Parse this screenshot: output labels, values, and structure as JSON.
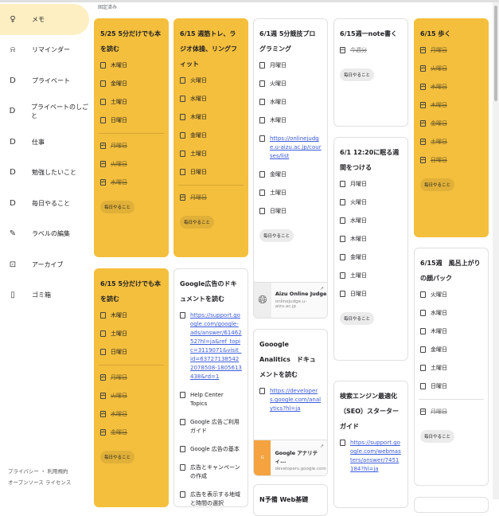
{
  "sidebar": {
    "items": [
      {
        "label": "メモ",
        "icon": "lightbulb-icon"
      },
      {
        "label": "リマインダー",
        "icon": "bell-icon"
      },
      {
        "label": "プライベート",
        "icon": "label-icon"
      },
      {
        "label": "プライベートのしごと",
        "icon": "label-icon"
      },
      {
        "label": "仕事",
        "icon": "label-icon"
      },
      {
        "label": "勉強したいこと",
        "icon": "label-icon"
      },
      {
        "label": "毎日やること",
        "icon": "label-icon"
      },
      {
        "label": "ラベルの編集",
        "icon": "pencil-icon"
      },
      {
        "label": "アーカイブ",
        "icon": "archive-icon"
      },
      {
        "label": "ゴミ箱",
        "icon": "trash-icon"
      }
    ],
    "footer": {
      "privacy": "プライバシー ・ 利用規約",
      "oss": "オープンソース ライセンス"
    }
  },
  "section": {
    "pinned": "固定済み"
  },
  "colors": {
    "yellow": "#f4bf3d",
    "active": "#feefc3"
  },
  "notes": [
    {
      "title": "5/25 5分だけでも本を読む",
      "color": "yellow",
      "items": [
        "木曜日",
        "金曜日",
        "土曜日",
        "日曜日"
      ],
      "done": [
        "月曜日",
        "火曜日",
        "水曜日"
      ],
      "label": "毎日やること"
    },
    {
      "title": "6/15 5分だけでも本を読む",
      "color": "yellow",
      "items": [
        "木曜日",
        "土曜日",
        "日曜日"
      ],
      "done": [
        "月曜日",
        "火曜日",
        "水曜日",
        "金曜日"
      ],
      "label": "毎日やること"
    },
    {
      "title": "6/15 週筋トレ、ラジオ体操、リングフィット",
      "color": "yellow",
      "items": [
        "火曜日",
        "水曜日",
        "木曜日",
        "金曜日",
        "土曜日",
        "日曜日"
      ],
      "done": [
        "月曜日"
      ],
      "label": "毎日やること"
    },
    {
      "title": "Google広告のドキュメントを読む",
      "color": "white",
      "items": [
        "https://support.google.com/google-ads/answer/6146252?hl=ja&ref_topic=3119071&visit_id=637271385422078508-1805613438&rd=1",
        "Help Center Topics",
        "Google 広告ご利用ガイド",
        "Google 広告の基本",
        "広告とキャンペーンの作成",
        "広告を表示する地域と時間の選択"
      ],
      "done": []
    },
    {
      "title": "6/1週 5分競技プログラミング",
      "color": "white",
      "items": [
        "月曜日",
        "火曜日",
        "水曜日",
        "木曜日",
        "https://onlinejudge.u-aizu.ac.jp/courses/list",
        "金曜日",
        "土曜日",
        "日曜日"
      ],
      "done": [],
      "label": "毎日やること",
      "preview": {
        "title": "Aizu Online Judge",
        "domain": "onlinejudge.u-aizu.ac.jp",
        "icon": "globe-icon"
      }
    },
    {
      "title": "Gooogle Analitics　ドキュメントを読む",
      "color": "white",
      "items": [
        "https://developers.google.com/analytics?hl=ja"
      ],
      "done": [],
      "preview": {
        "title": "Google アナリティ...",
        "domain": "developers.google.com",
        "icon": "google-developers-thumb"
      }
    },
    {
      "title": "N予備 Web基礎",
      "color": "white",
      "items": [],
      "done": []
    },
    {
      "title": "6/15週一note書く",
      "color": "white",
      "items": [],
      "done": [
        "今週分"
      ],
      "label": "毎日やること"
    },
    {
      "title": "6/1 12:20に眠る週間をつける",
      "color": "white",
      "items": [
        "月曜日",
        "火曜日",
        "水曜日",
        "木曜日",
        "金曜日",
        "土曜日",
        "日曜日"
      ],
      "done": [],
      "label": "毎日やること"
    },
    {
      "title": "検索エンジン最適化（SEO）スターター ガイド",
      "color": "white",
      "items": [
        "https://support.google.com/webmasters/answer/7451184?hl=ja"
      ],
      "done": []
    },
    {
      "title": "6/15 歩く",
      "color": "yellow",
      "items": [],
      "done": [
        "月曜日",
        "火曜日",
        "水曜日",
        "木曜日",
        "金曜日",
        "土曜日",
        "日曜日"
      ],
      "label": "毎日やること"
    },
    {
      "title": "6/15週　風呂上がりの顔パック",
      "color": "white",
      "items": [
        "火曜日",
        "水曜日",
        "木曜日",
        "金曜日",
        "土曜日",
        "日曜日"
      ],
      "done": [
        "月曜日"
      ],
      "label": "毎日やること"
    },
    {
      "title": "",
      "color": "white",
      "items": [],
      "done": []
    }
  ]
}
